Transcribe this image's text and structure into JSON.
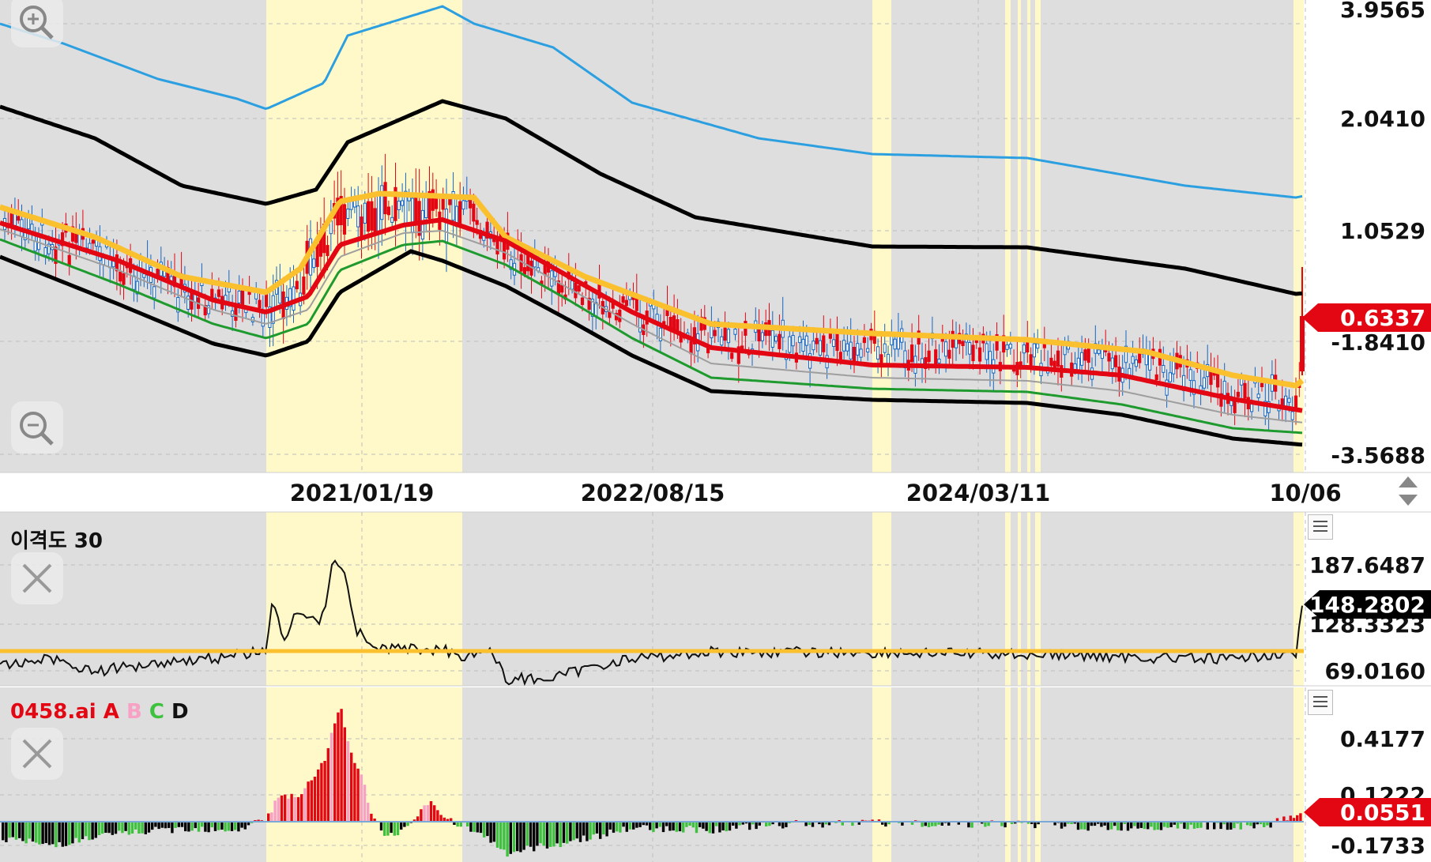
{
  "colors": {
    "upper_band": "#2b9fe0",
    "envelope": "#000000",
    "ma_orange": "#fbc02d",
    "ma_red": "#e30613",
    "ma_gray": "#9e9e9e",
    "ma_green": "#1e9a2e",
    "candle_up": "#e30613",
    "candle_down": "#1565c0",
    "shade_gray": "#dedede",
    "shade_yellow": "#fff9c9",
    "hist_a": "#e30613",
    "hist_b": "#f7a1c4",
    "hist_c": "#3ec23e",
    "hist_d": "#000000"
  },
  "toolbar": {
    "zoom_in_icon": "zoom-in-icon",
    "zoom_out_icon": "zoom-out-icon",
    "scroll_icon": "up-down-arrows-icon"
  },
  "price_axis": {
    "labels": [
      "3.9565",
      "2.0410",
      "1.0529",
      "-1.8410",
      "-3.5688"
    ],
    "current": "0.6337"
  },
  "x_axis": {
    "labels": [
      "2021/01/19",
      "2022/08/15",
      "2024/03/11",
      "10/06"
    ]
  },
  "disparity": {
    "title": "이격도 30",
    "axis_labels": [
      "187.6487",
      "128.3323",
      "69.0160"
    ],
    "current": "148.2802",
    "close_icon": "close-icon",
    "menu_icon": "hamburger-menu-icon"
  },
  "ai_indicator": {
    "title_prefix": "0458.ai",
    "legend": [
      "A",
      "B",
      "C",
      "D"
    ],
    "axis_labels": [
      "0.4177",
      "0.1222",
      "-0.1733"
    ],
    "current": "0.0551",
    "close_icon": "close-icon",
    "menu_icon": "hamburger-menu-icon"
  }
}
